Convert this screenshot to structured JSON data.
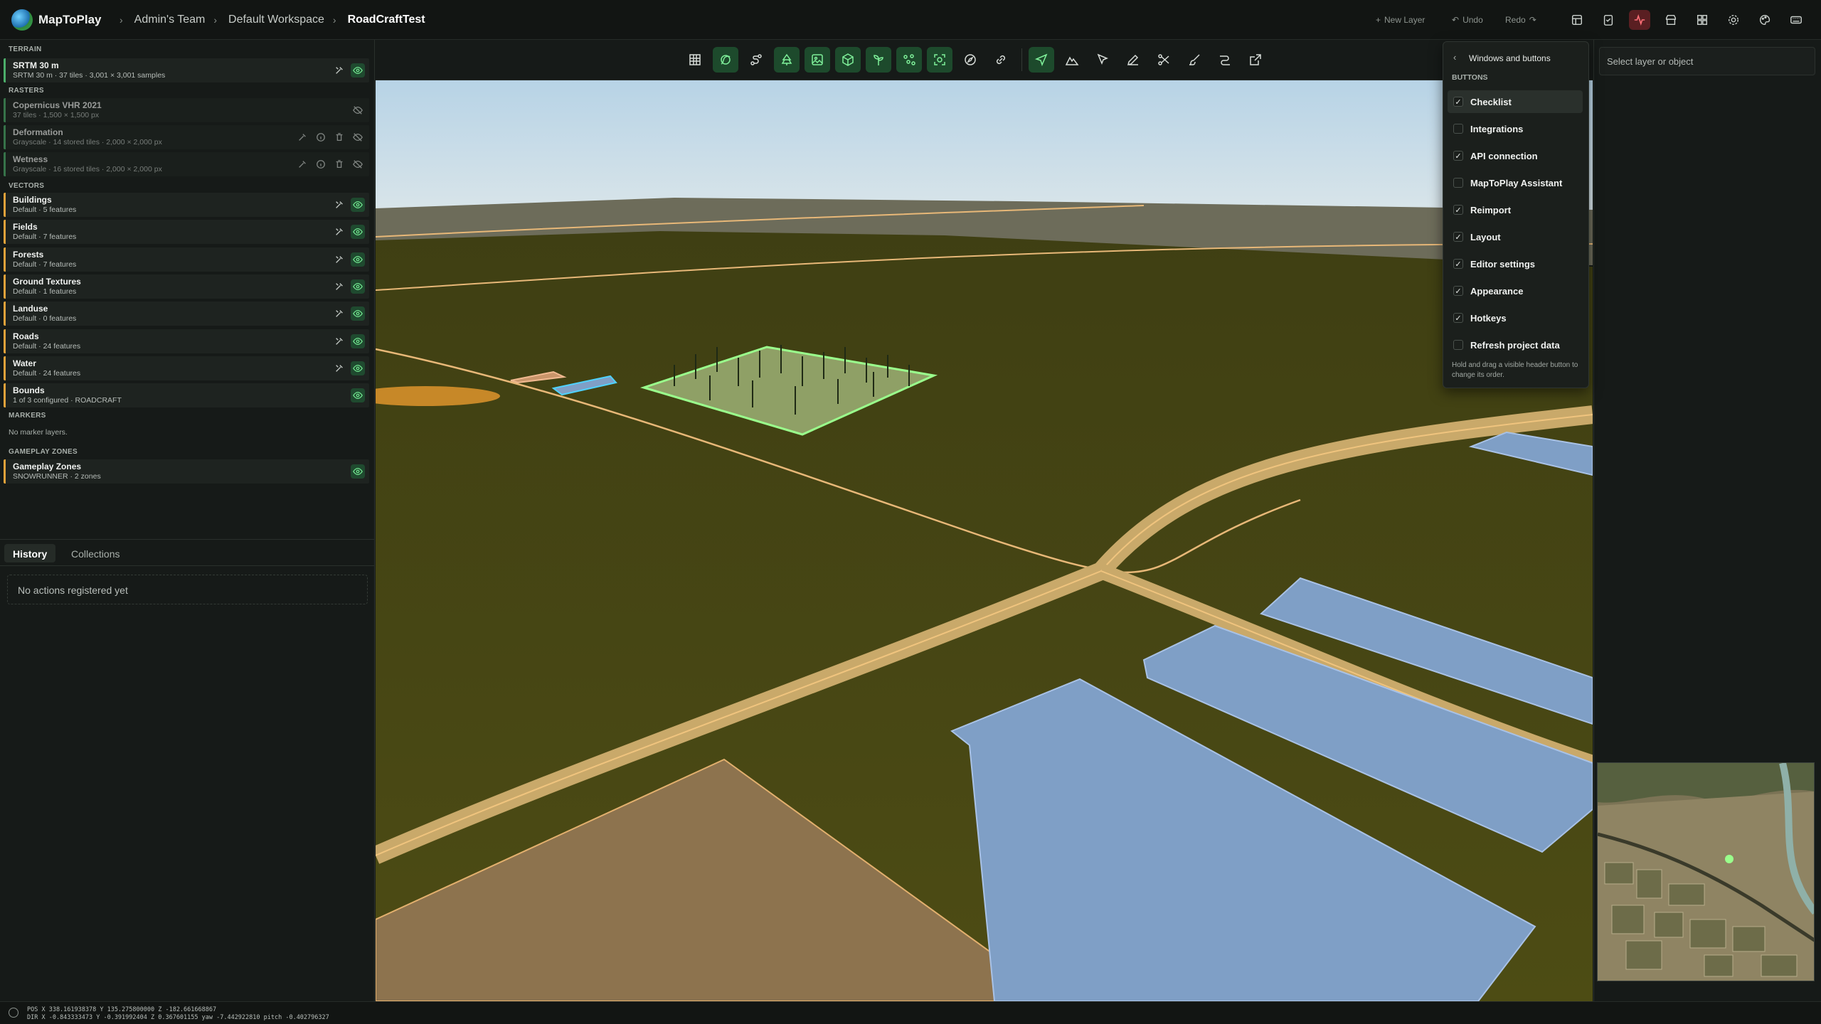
{
  "header": {
    "app_name": "MapToPlay",
    "breadcrumbs": [
      "Admin's Team",
      "Default Workspace",
      "RoadCraftTest"
    ],
    "new_layer": "New Layer",
    "undo": "Undo",
    "redo": "Redo",
    "icons": [
      "layout-icon",
      "checklist-icon",
      "activity-icon",
      "store-icon",
      "integrations-icon",
      "settings-icon",
      "palette-icon",
      "keyboard-icon"
    ]
  },
  "layers": {
    "terrain_title": "TERRAIN",
    "terrain": [
      {
        "name": "SRTM 30 m",
        "sub": "SRTM 30 m · 37 tiles · 3,001 × 3,001 samples"
      }
    ],
    "rasters_title": "RASTERS",
    "rasters": [
      {
        "name": "Copernicus VHR 2021",
        "sub": "37 tiles · 1,500 × 1,500 px"
      },
      {
        "name": "Deformation",
        "sub": "Grayscale · 14 stored tiles · 2,000 × 2,000 px"
      },
      {
        "name": "Wetness",
        "sub": "Grayscale · 16 stored tiles · 2,000 × 2,000 px"
      }
    ],
    "vectors_title": "VECTORS",
    "vectors": [
      {
        "name": "Buildings",
        "sub": "Default · 5 features"
      },
      {
        "name": "Fields",
        "sub": "Default · 7 features"
      },
      {
        "name": "Forests",
        "sub": "Default · 7 features"
      },
      {
        "name": "Ground Textures",
        "sub": "Default · 1 features"
      },
      {
        "name": "Landuse",
        "sub": "Default · 0 features"
      },
      {
        "name": "Roads",
        "sub": "Default · 24 features"
      },
      {
        "name": "Water",
        "sub": "Default · 24 features"
      },
      {
        "name": "Bounds",
        "sub": "1 of 3 configured · ROADCRAFT"
      }
    ],
    "markers_title": "MARKERS",
    "markers_empty": "No marker layers.",
    "zones_title": "GAMEPLAY ZONES",
    "zones": [
      {
        "name": "Gameplay Zones",
        "sub": "SNOWRUNNER · 2 zones"
      }
    ]
  },
  "history": {
    "tabs": [
      "History",
      "Collections"
    ],
    "active_tab": "History",
    "empty": "No actions registered yet"
  },
  "right_panel": {
    "select_placeholder": "Select layer or object"
  },
  "dropdown": {
    "title": "Windows and buttons",
    "section": "BUTTONS",
    "items": [
      {
        "label": "Checklist",
        "checked": true
      },
      {
        "label": "Integrations",
        "checked": false
      },
      {
        "label": "API connection",
        "checked": true
      },
      {
        "label": "MapToPlay Assistant",
        "checked": false
      },
      {
        "label": "Reimport",
        "checked": true
      },
      {
        "label": "Layout",
        "checked": true
      },
      {
        "label": "Editor settings",
        "checked": true
      },
      {
        "label": "Appearance",
        "checked": true
      },
      {
        "label": "Hotkeys",
        "checked": true
      },
      {
        "label": "Refresh project data",
        "checked": false
      }
    ],
    "note": "Hold and drag a visible header button to change its order."
  },
  "status": {
    "pos": "POS X 338.161938378 Y 135.275800000 Z -182.661668867",
    "dir": "DIR X -0.843333473 Y -0.391992404 Z 0.367601155 yaw -7.442922810 pitch -0.402796327"
  },
  "colors": {
    "accent": "#4caf6a",
    "active_red": "#ff6f77",
    "road": "#e8b878",
    "water": "#7f9fc6",
    "terrain": "#4a4a12"
  }
}
